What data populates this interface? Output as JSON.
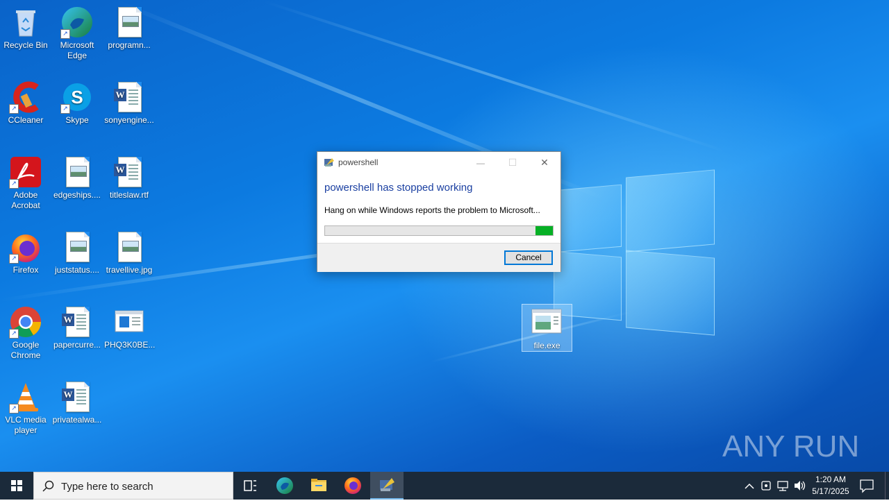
{
  "desktop": {
    "icons": [
      {
        "label": "Recycle Bin",
        "icon": "recycle-bin-icon"
      },
      {
        "label": "Microsoft Edge",
        "icon": "edge-icon"
      },
      {
        "label": "programn...",
        "icon": "image-file-icon"
      },
      {
        "label": "CCleaner",
        "icon": "ccleaner-icon"
      },
      {
        "label": "Skype",
        "icon": "skype-icon"
      },
      {
        "label": "sonyengine...",
        "icon": "word-doc-icon"
      },
      {
        "label": "Adobe Acrobat",
        "icon": "acrobat-icon"
      },
      {
        "label": "edgeships....",
        "icon": "image-file-icon"
      },
      {
        "label": "titleslaw.rtf",
        "icon": "word-doc-icon"
      },
      {
        "label": "Firefox",
        "icon": "firefox-icon"
      },
      {
        "label": "juststatus....",
        "icon": "image-file-icon"
      },
      {
        "label": "travellive.jpg",
        "icon": "image-file-icon"
      },
      {
        "label": "Google Chrome",
        "icon": "chrome-icon"
      },
      {
        "label": "papercurre...",
        "icon": "word-doc-icon"
      },
      {
        "label": "PHQ3K0BE...",
        "icon": "window-file-icon"
      },
      {
        "label": "VLC media player",
        "icon": "vlc-icon"
      },
      {
        "label": "privatealwa...",
        "icon": "word-doc-icon"
      }
    ],
    "selected_icon": {
      "label": "file.exe",
      "icon": "exe-file-icon"
    }
  },
  "dialog": {
    "title": "powershell",
    "heading": "powershell has stopped working",
    "message": "Hang on while Windows reports the problem to Microsoft...",
    "cancel_label": "Cancel",
    "minimize_glyph": "—",
    "maximize_glyph": "☐",
    "close_glyph": "✕",
    "progress_color": "#06b025"
  },
  "taskbar": {
    "search_placeholder": "Type here to search",
    "time": "1:20 AM",
    "date": "5/17/2025",
    "pinned": [
      "start-icon",
      "task-view-icon",
      "edge-icon",
      "file-explorer-icon",
      "firefox-icon",
      "powershell-crash-icon"
    ]
  },
  "watermark": {
    "text": "ANY RUN"
  }
}
